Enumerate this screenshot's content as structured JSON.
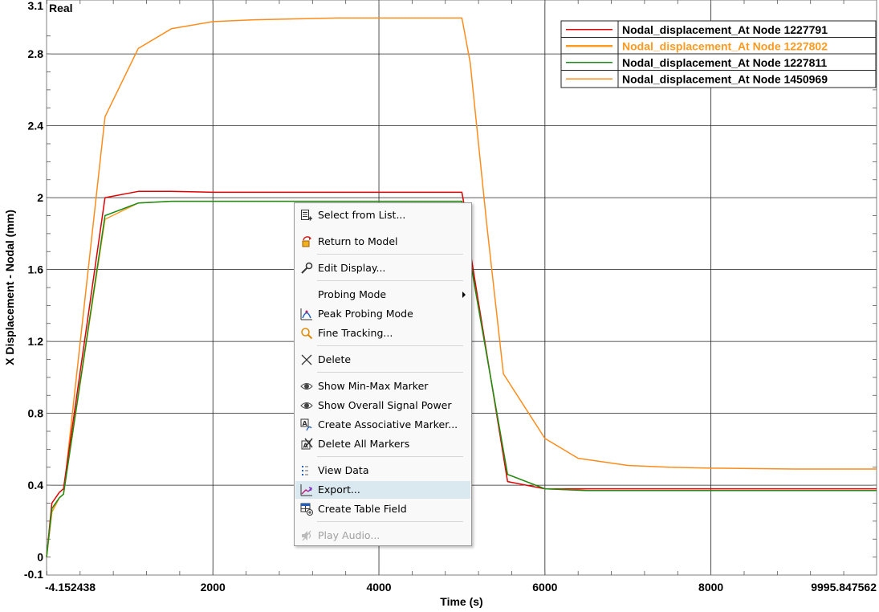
{
  "chart_data": {
    "type": "line",
    "corner_label": "Real",
    "xlabel": "Time (s)",
    "ylabel": "X Displacement - Nodal (mm)",
    "xlim": [
      -4.152438,
      9995.847562
    ],
    "ylim": [
      -0.1,
      3.1
    ],
    "x_ticks": [
      {
        "value": -4.152438,
        "label": "-4.152438"
      },
      {
        "value": 2000,
        "label": "2000"
      },
      {
        "value": 4000,
        "label": "4000"
      },
      {
        "value": 6000,
        "label": "6000"
      },
      {
        "value": 8000,
        "label": "8000"
      },
      {
        "value": 9995.847562,
        "label": "9995.847562"
      }
    ],
    "y_ticks": [
      {
        "value": 3.1,
        "label": "3.1"
      },
      {
        "value": 2.8,
        "label": "2.8"
      },
      {
        "value": 2.4,
        "label": "2.4"
      },
      {
        "value": 2.0,
        "label": "2"
      },
      {
        "value": 1.6,
        "label": "1.6"
      },
      {
        "value": 1.2,
        "label": "1.2"
      },
      {
        "value": 0.8,
        "label": "0.8"
      },
      {
        "value": 0.4,
        "label": "0.4"
      },
      {
        "value": 0.0,
        "label": "0"
      },
      {
        "value": -0.1,
        "label": "-0.1"
      }
    ],
    "x_gridlines": [
      2000,
      4000,
      6000,
      8000
    ],
    "y_gridlines": [
      2.8,
      2.4,
      2.0,
      1.6,
      1.2,
      0.8,
      0.4
    ],
    "grid": true,
    "legend_position": "top-right",
    "series": [
      {
        "name": "Nodal_displacement_At Node 1227791",
        "color": "#e00000",
        "highlight": false,
        "x": [
          -4,
          60,
          150,
          200,
          700,
          1100,
          1500,
          2000,
          3000,
          4000,
          4500,
          5000,
          5050,
          5100,
          5550,
          6000,
          6500,
          7000,
          8000,
          9000,
          9996
        ],
        "y": [
          0.0,
          0.3,
          0.36,
          0.38,
          2.0,
          2.035,
          2.035,
          2.03,
          2.03,
          2.03,
          2.03,
          2.03,
          1.9,
          1.7,
          0.42,
          0.38,
          0.38,
          0.38,
          0.38,
          0.38,
          0.38
        ]
      },
      {
        "name": "Nodal_displacement_At Node 1227802",
        "color": "#ff9a20",
        "highlight": true,
        "x": [
          -4,
          60,
          150,
          200,
          700,
          1100,
          1500,
          2000,
          2500,
          3000,
          4000,
          4500,
          5000,
          5050,
          5100,
          5550,
          6000,
          6500,
          7000,
          8000,
          9000,
          9996
        ],
        "y": [
          0.0,
          0.25,
          0.33,
          0.35,
          1.88,
          1.97,
          1.98,
          1.98,
          1.98,
          1.98,
          1.98,
          1.98,
          1.98,
          1.85,
          1.65,
          0.46,
          0.38,
          0.37,
          0.37,
          0.37,
          0.37,
          0.37
        ]
      },
      {
        "name": "Nodal_displacement_At Node 1227811",
        "color": "#1a8c1a",
        "highlight": false,
        "x": [
          -4,
          60,
          150,
          200,
          700,
          1100,
          1500,
          2000,
          2500,
          3000,
          4000,
          4500,
          5000,
          5050,
          5100,
          5550,
          6000,
          6500,
          7000,
          8000,
          9000,
          9996
        ],
        "y": [
          0.0,
          0.27,
          0.33,
          0.35,
          1.9,
          1.97,
          1.98,
          1.98,
          1.98,
          1.98,
          1.98,
          1.98,
          1.98,
          1.85,
          1.65,
          0.46,
          0.38,
          0.37,
          0.37,
          0.37,
          0.37,
          0.37
        ]
      },
      {
        "name": "Nodal_displacement_At Node 1450969",
        "color": "#ff8c1a",
        "highlight": false,
        "x": [
          -4,
          60,
          150,
          200,
          700,
          1100,
          1500,
          2000,
          2500,
          3000,
          3500,
          4000,
          4500,
          5000,
          5100,
          5300,
          5500,
          6000,
          6400,
          7000,
          7500,
          8000,
          9000,
          9996
        ],
        "y": [
          0.0,
          0.25,
          0.33,
          0.35,
          2.45,
          2.83,
          2.94,
          2.98,
          2.99,
          2.995,
          3.0,
          3.0,
          3.0,
          3.0,
          2.75,
          1.85,
          1.02,
          0.66,
          0.55,
          0.51,
          0.5,
          0.495,
          0.49,
          0.49
        ]
      }
    ]
  },
  "context_menu": {
    "items": [
      {
        "key": "select",
        "label": "Select from List...",
        "icon": "list-select-icon"
      },
      {
        "key": "return",
        "label": "Return to Model",
        "icon": "return-model-icon"
      },
      {
        "key": "edit",
        "label": "Edit Display...",
        "icon": "wrench-icon"
      },
      {
        "key": "probing",
        "label": "Probing Mode",
        "icon": "",
        "submenu": true
      },
      {
        "key": "peak",
        "label": "Peak Probing Mode",
        "icon": "peak-probe-icon"
      },
      {
        "key": "fine",
        "label": "Fine Tracking...",
        "icon": "magnifier-icon"
      },
      {
        "key": "delete",
        "label": "Delete",
        "icon": "cross-icon"
      },
      {
        "key": "minmax",
        "label": "Show Min-Max Marker",
        "icon": "eye-icon"
      },
      {
        "key": "power",
        "label": "Show Overall Signal Power",
        "icon": "eye-icon"
      },
      {
        "key": "assoc",
        "label": "Create Associative Marker...",
        "icon": "marker-icon"
      },
      {
        "key": "delmarkers",
        "label": "Delete All Markers",
        "icon": "delete-markers-icon"
      },
      {
        "key": "viewdata",
        "label": "View Data",
        "icon": "data-list-icon"
      },
      {
        "key": "export",
        "label": "Export...",
        "icon": "export-chart-icon",
        "highlighted": true
      },
      {
        "key": "table",
        "label": "Create Table Field",
        "icon": "table-add-icon"
      },
      {
        "key": "audio",
        "label": "Play Audio...",
        "icon": "audio-icon",
        "disabled": true
      }
    ]
  }
}
